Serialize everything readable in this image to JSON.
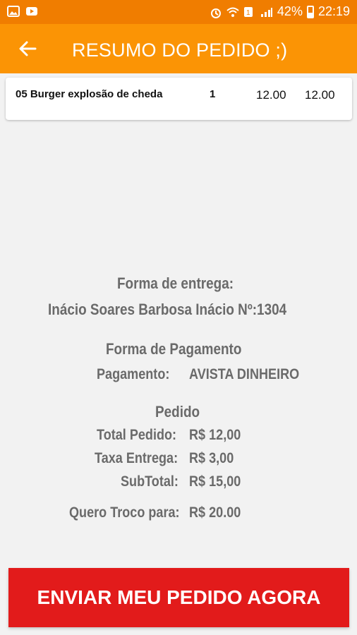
{
  "status": {
    "battery": "42%",
    "time": "22:19",
    "bg_color": "#f07d00"
  },
  "appbar": {
    "title": "RESUMO DO PEDIDO ;)",
    "back_icon": "arrow-left-icon",
    "bg_color": "#fb9405"
  },
  "order_item": {
    "name": "05 Burger explosão de cheda",
    "qty": "1",
    "unit_price": "12.00",
    "total": "12.00"
  },
  "delivery": {
    "heading": "Forma de entrega:",
    "address": "Inácio Soares Barbosa Inácio  Nº:1304"
  },
  "payment": {
    "heading": "Forma de Pagamento",
    "label": "Pagamento:",
    "value": "AVISTA DINHEIRO"
  },
  "order": {
    "heading": "Pedido",
    "total_label": "Total Pedido:",
    "total_value": "R$ 12,00",
    "fee_label": "Taxa Entrega:",
    "fee_value": "R$ 3,00",
    "subtotal_label": "SubTotal:",
    "subtotal_value": "R$ 15,00",
    "change_label": "Quero Troco para:",
    "change_value": "R$ 20.00"
  },
  "cta": {
    "label": "ENVIAR MEU PEDIDO AGORA",
    "color": "#e21b1b"
  }
}
